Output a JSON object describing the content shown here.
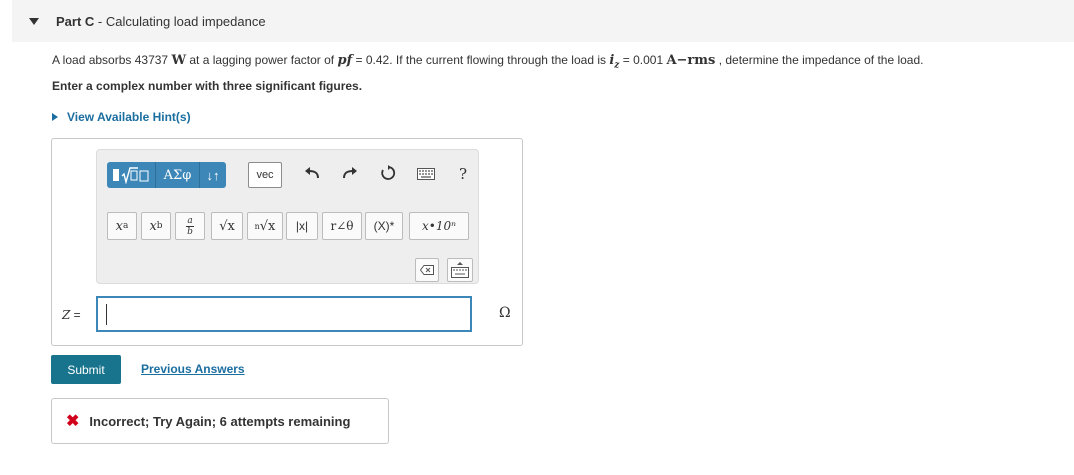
{
  "part": {
    "label": "Part C",
    "separator": " - ",
    "title": "Calculating load impedance"
  },
  "problem": {
    "s1": "A load absorbs 43737 ",
    "unit_w": "W",
    "s2": " at a lagging power factor of ",
    "pf_var": "pf",
    "s3": " = 0.42. If the current flowing through the load is ",
    "i_var": "i",
    "i_sub": "z",
    "s4": " = 0.001 ",
    "unit_a": "A−rms",
    "s5": " , determine the impedance of the load."
  },
  "instruction": "Enter a complex number with three significant figures.",
  "hint": {
    "label": "View Available Hint(s)"
  },
  "toolbar": {
    "greek": "ΑΣφ",
    "arrows": "↓↑",
    "vec": "vec",
    "undo_icon": "undo-icon",
    "redo_icon": "redo-icon",
    "reset_icon": "reset-icon",
    "keyboard_icon": "keyboard-icon",
    "help": "?"
  },
  "symbols": {
    "power_base": "x",
    "power_exp": "a",
    "sub_base": "x",
    "sub_sub": "b",
    "frac_num": "a",
    "frac_den": "b",
    "sqrt": "√x",
    "nroot_n": "n",
    "nroot": "√x",
    "abs": "|x|",
    "polar": "r∠θ",
    "conj": "(X)*",
    "sci": "x•10ⁿ"
  },
  "answer": {
    "label": "Z",
    "equals": " =",
    "value": "",
    "unit": "Ω"
  },
  "actions": {
    "submit": "Submit",
    "previous_answers": "Previous Answers"
  },
  "feedback": {
    "icon": "✖",
    "message": "Incorrect; Try Again; 6 attempts remaining"
  }
}
